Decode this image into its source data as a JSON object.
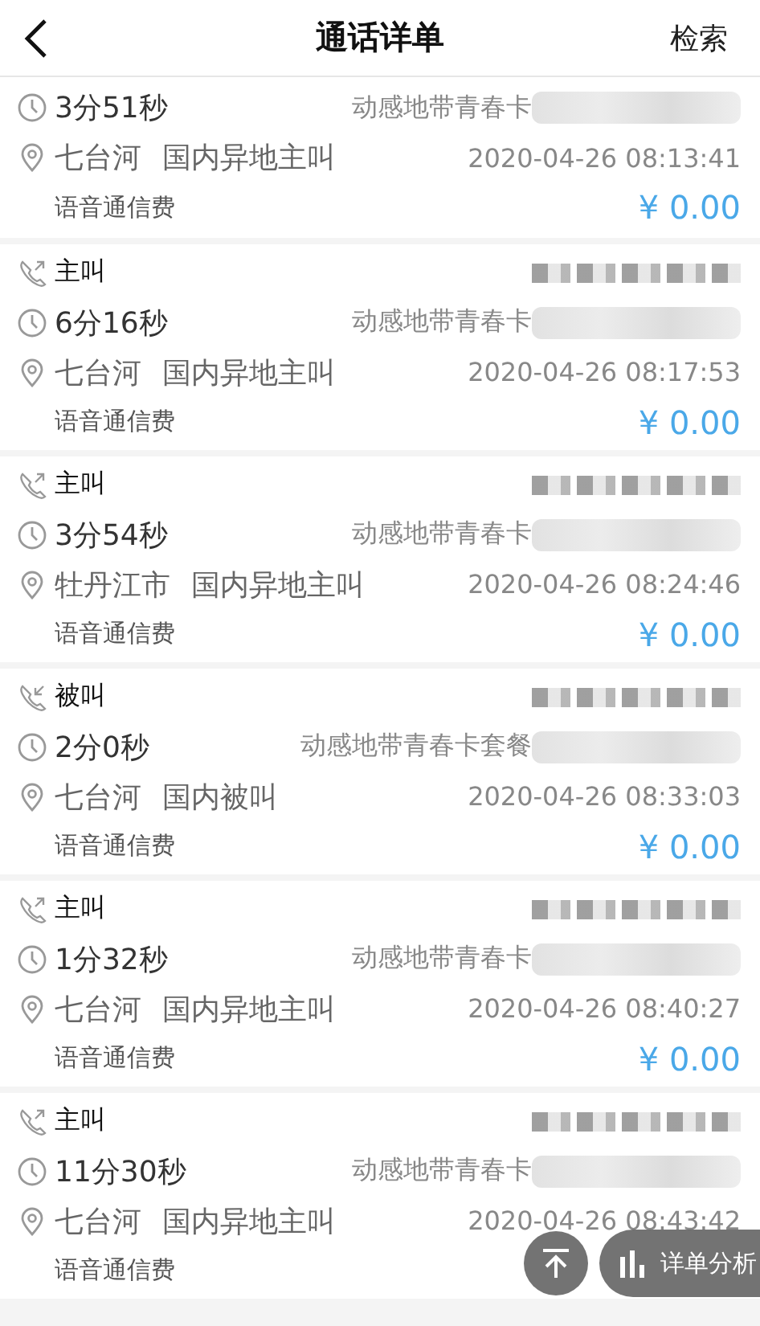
{
  "header": {
    "title": "通话详单",
    "action": "检索"
  },
  "records": [
    {
      "duration": "3分51秒",
      "plan": "动感地带青春卡",
      "place": "七台河",
      "call_desc": "国内异地主叫",
      "datetime": "2020-04-26 08:13:41",
      "fee_type": "语音通信费",
      "amount": "¥ 0.00"
    },
    {
      "kind": "outgoing",
      "call_type": "主叫",
      "duration": "6分16秒",
      "plan": "动感地带青春卡",
      "place": "七台河",
      "call_desc": "国内异地主叫",
      "datetime": "2020-04-26 08:17:53",
      "fee_type": "语音通信费",
      "amount": "¥ 0.00"
    },
    {
      "kind": "outgoing",
      "call_type": "主叫",
      "duration": "3分54秒",
      "plan": "动感地带青春卡",
      "place": "牡丹江市",
      "call_desc": "国内异地主叫",
      "datetime": "2020-04-26 08:24:46",
      "fee_type": "语音通信费",
      "amount": "¥ 0.00"
    },
    {
      "kind": "incoming",
      "call_type": "被叫",
      "duration": "2分0秒",
      "plan": "动感地带青春卡套餐",
      "place": "七台河",
      "call_desc": "国内被叫",
      "datetime": "2020-04-26 08:33:03",
      "fee_type": "语音通信费",
      "amount": "¥ 0.00"
    },
    {
      "kind": "outgoing",
      "call_type": "主叫",
      "duration": "1分32秒",
      "plan": "动感地带青春卡",
      "place": "七台河",
      "call_desc": "国内异地主叫",
      "datetime": "2020-04-26 08:40:27",
      "fee_type": "语音通信费",
      "amount": "¥ 0.00"
    },
    {
      "kind": "outgoing",
      "call_type": "主叫",
      "duration": "11分30秒",
      "plan": "动感地带青春卡",
      "place": "七台河",
      "call_desc": "国内异地主叫",
      "datetime": "2020-04-26 08:43:42",
      "fee_type": "语音通信费"
    }
  ],
  "analysis_button": "详单分析"
}
